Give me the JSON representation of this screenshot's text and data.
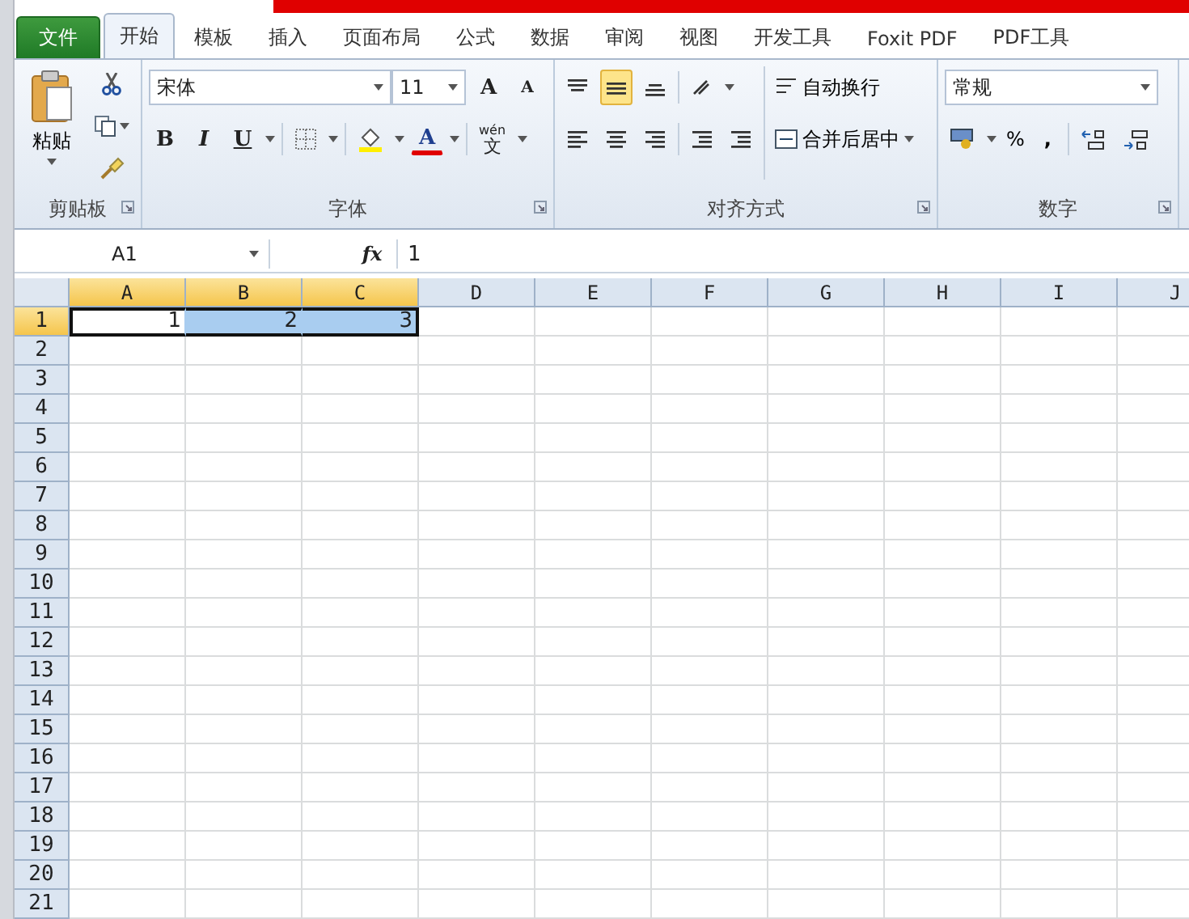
{
  "tabs": [
    {
      "label": "文件",
      "kind": "file",
      "selected": false
    },
    {
      "label": "开始",
      "kind": "tab",
      "selected": true
    },
    {
      "label": "模板",
      "kind": "tab",
      "selected": false
    },
    {
      "label": "插入",
      "kind": "tab",
      "selected": false
    },
    {
      "label": "页面布局",
      "kind": "tab",
      "selected": false
    },
    {
      "label": "公式",
      "kind": "tab",
      "selected": false
    },
    {
      "label": "数据",
      "kind": "tab",
      "selected": false
    },
    {
      "label": "审阅",
      "kind": "tab",
      "selected": false
    },
    {
      "label": "视图",
      "kind": "tab",
      "selected": false
    },
    {
      "label": "开发工具",
      "kind": "tab",
      "selected": false
    },
    {
      "label": "Foxit PDF",
      "kind": "tab",
      "selected": false
    },
    {
      "label": "PDF工具",
      "kind": "tab",
      "selected": false
    }
  ],
  "ribbon": {
    "clipboard": {
      "paste": "粘贴",
      "label": "剪贴板"
    },
    "font": {
      "font_name": "宋体",
      "font_size": "11",
      "grow": "A",
      "shrink": "A",
      "bold": "B",
      "italic": "I",
      "underline": "U",
      "font_color": "A",
      "phonetic_top": "wén",
      "phonetic_bottom": "文",
      "label": "字体"
    },
    "alignment": {
      "vertical": [
        {
          "kind": "top",
          "selected": false
        },
        {
          "kind": "middle",
          "selected": true
        },
        {
          "kind": "bottom",
          "selected": false
        }
      ],
      "wrap": "自动换行",
      "merge": "合并后居中",
      "label": "对齐方式"
    },
    "number": {
      "format": "常规",
      "percent": "%",
      "comma": ",",
      "label": "数字"
    }
  },
  "formula_bar": {
    "name_box": "A1",
    "fx": "fx",
    "value": "1"
  },
  "columns": [
    {
      "label": "A",
      "selected": true
    },
    {
      "label": "B",
      "selected": true
    },
    {
      "label": "C",
      "selected": true
    },
    {
      "label": "D",
      "selected": false
    },
    {
      "label": "E",
      "selected": false
    },
    {
      "label": "F",
      "selected": false
    },
    {
      "label": "G",
      "selected": false
    },
    {
      "label": "H",
      "selected": false
    },
    {
      "label": "I",
      "selected": false
    },
    {
      "label": "J",
      "selected": false
    }
  ],
  "rows": [
    {
      "label": "1",
      "selected": true,
      "cells": [
        {
          "value": "1",
          "active": true,
          "selected": true
        },
        {
          "value": "2",
          "active": false,
          "selected": true
        },
        {
          "value": "3",
          "active": false,
          "selected": true
        }
      ]
    },
    {
      "label": "2",
      "selected": false,
      "cells": []
    },
    {
      "label": "3",
      "selected": false,
      "cells": []
    },
    {
      "label": "4",
      "selected": false,
      "cells": []
    },
    {
      "label": "5",
      "selected": false,
      "cells": []
    },
    {
      "label": "6",
      "selected": false,
      "cells": []
    },
    {
      "label": "7",
      "selected": false,
      "cells": []
    },
    {
      "label": "8",
      "selected": false,
      "cells": []
    },
    {
      "label": "9",
      "selected": false,
      "cells": []
    },
    {
      "label": "10",
      "selected": false,
      "cells": []
    },
    {
      "label": "11",
      "selected": false,
      "cells": []
    },
    {
      "label": "12",
      "selected": false,
      "cells": []
    },
    {
      "label": "13",
      "selected": false,
      "cells": []
    },
    {
      "label": "14",
      "selected": false,
      "cells": []
    },
    {
      "label": "15",
      "selected": false,
      "cells": []
    },
    {
      "label": "16",
      "selected": false,
      "cells": []
    },
    {
      "label": "17",
      "selected": false,
      "cells": []
    },
    {
      "label": "18",
      "selected": false,
      "cells": []
    },
    {
      "label": "19",
      "selected": false,
      "cells": []
    },
    {
      "label": "20",
      "selected": false,
      "cells": []
    },
    {
      "label": "21",
      "selected": false,
      "cells": []
    }
  ]
}
